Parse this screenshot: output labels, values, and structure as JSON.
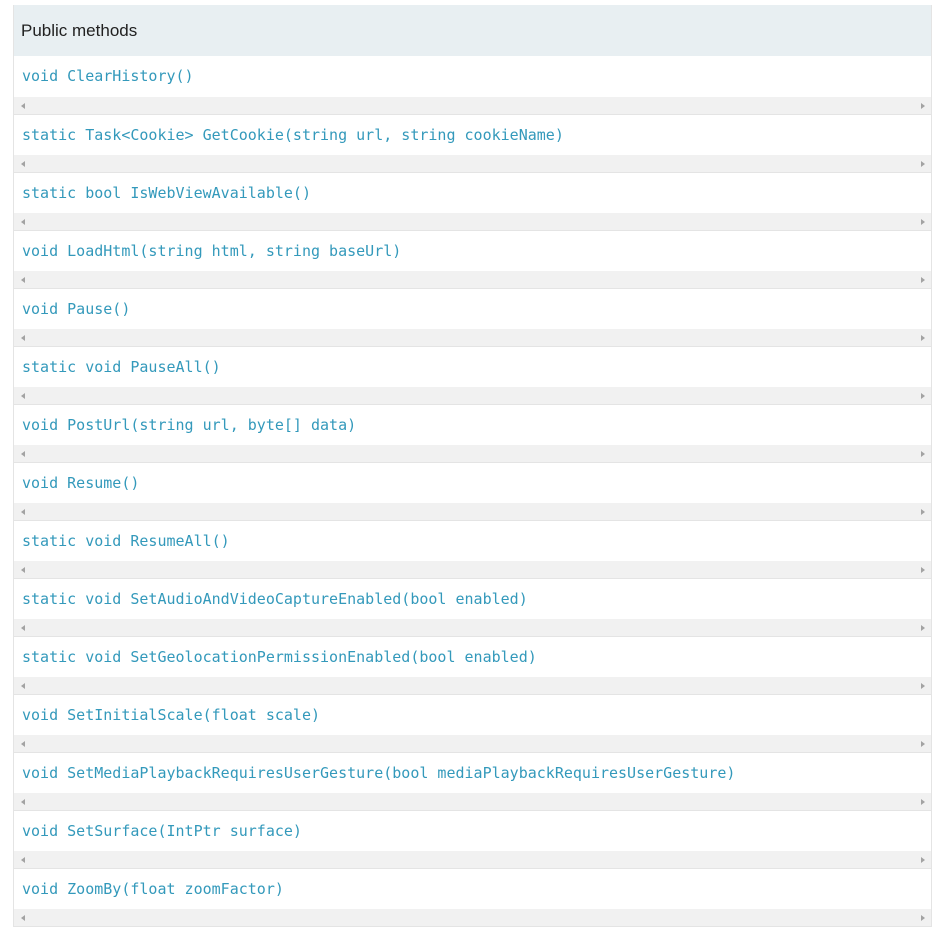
{
  "header": {
    "title": "Public methods"
  },
  "colors": {
    "header_bg": "#e8eff2",
    "link": "#3399bb",
    "scrollbar_track": "#f1f1f1",
    "border": "#e4e4e4"
  },
  "methods": [
    {
      "signature": "void ClearHistory()"
    },
    {
      "signature": "static Task<Cookie> GetCookie(string url, string cookieName)"
    },
    {
      "signature": "static bool IsWebViewAvailable()"
    },
    {
      "signature": "void LoadHtml(string html, string baseUrl)"
    },
    {
      "signature": "void Pause()"
    },
    {
      "signature": "static void PauseAll()"
    },
    {
      "signature": "void PostUrl(string url, byte[] data)"
    },
    {
      "signature": "void Resume()"
    },
    {
      "signature": "static void ResumeAll()"
    },
    {
      "signature": "static void SetAudioAndVideoCaptureEnabled(bool enabled)"
    },
    {
      "signature": "static void SetGeolocationPermissionEnabled(bool enabled)"
    },
    {
      "signature": "void SetInitialScale(float scale)"
    },
    {
      "signature": "void SetMediaPlaybackRequiresUserGesture(bool mediaPlaybackRequiresUserGesture)"
    },
    {
      "signature": "void SetSurface(IntPtr surface)"
    },
    {
      "signature": "void ZoomBy(float zoomFactor)"
    }
  ]
}
